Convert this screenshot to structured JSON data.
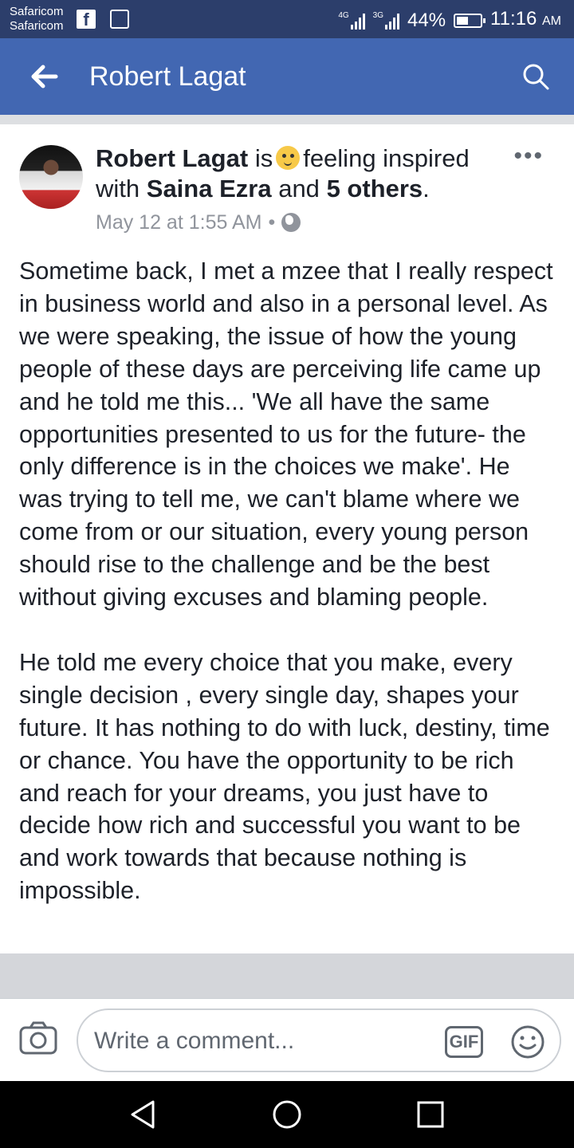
{
  "status_bar": {
    "carrier_1": "Safaricom",
    "carrier_2": "Safaricom",
    "net_1": "4G",
    "net_2": "3G",
    "battery": "44%",
    "time": "11:16",
    "ampm": "AM"
  },
  "app_bar": {
    "title": "Robert Lagat"
  },
  "post": {
    "author": "Robert Lagat",
    "is": "is",
    "feeling": "feeling inspired",
    "with": "with",
    "tagged": "Saina Ezra",
    "and": "and",
    "others": "5 others",
    "period": ".",
    "timestamp": "May 12 at 1:55 AM",
    "dot": "•",
    "body": "Sometime back, I met a mzee that I really respect in business world and also in a personal level. As we were speaking, the issue of how the young people of these days are perceiving life came up and he told me this... 'We all have the same opportunities presented to us for the future- the only difference is in the choices we make'. He was trying to tell me, we can't blame where we come from or our situation, every young person should rise to the challenge and be the best without giving excuses and blaming people.\n\nHe told me every choice that you make, every single decision , every single day, shapes your future. It has nothing to do with luck, destiny, time or chance. You have the opportunity to be rich and reach for your dreams, you just have to decide how rich and successful you want to be and work towards that because nothing is impossible."
  },
  "comment_bar": {
    "placeholder": "Write a comment...",
    "gif_label": "GIF"
  },
  "colors": {
    "status_bar": "#2c3e6b",
    "app_bar": "#4267b2",
    "text": "#1d2129",
    "meta": "#90949c"
  },
  "icons": [
    "facebook-icon",
    "gallery-icon",
    "signal-icon",
    "battery-icon",
    "back-arrow-icon",
    "search-icon",
    "feeling-emoji-icon",
    "more-icon",
    "globe-icon",
    "camera-icon",
    "gif-icon",
    "emoji-icon",
    "nav-back-icon",
    "nav-home-icon",
    "nav-recents-icon"
  ]
}
